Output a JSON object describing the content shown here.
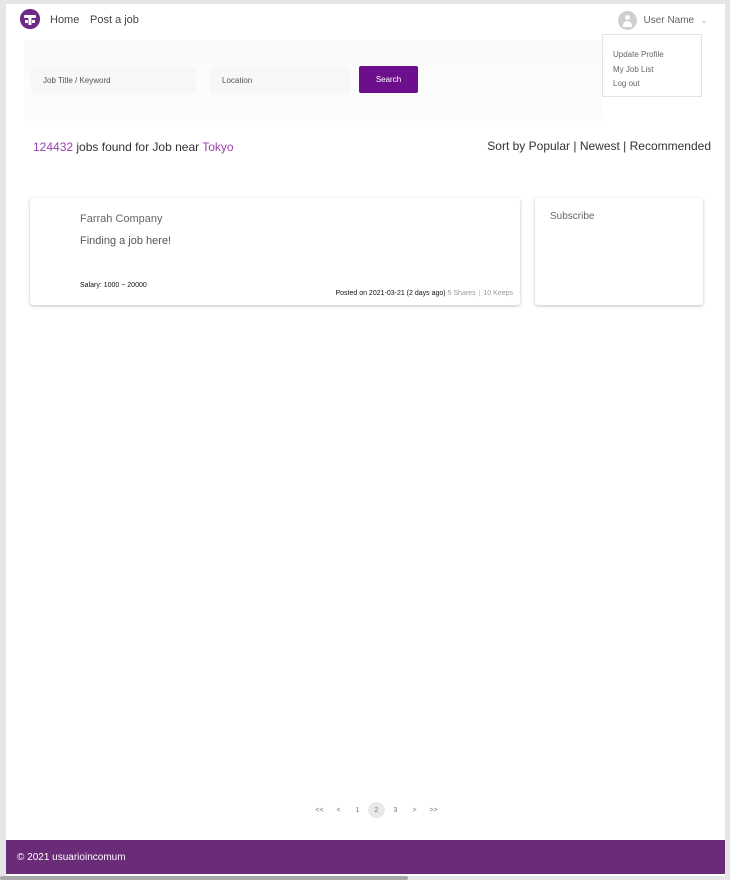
{
  "nav": {
    "home_label": "Home",
    "post_job_label": "Post a job"
  },
  "user": {
    "name": "User Name",
    "chevron": "⌄",
    "menu": [
      "Update Profile",
      "My Job List",
      "Log out"
    ]
  },
  "search": {
    "keyword_placeholder": "Job Title / Keyword",
    "location_placeholder": "Location",
    "button_label": "Search"
  },
  "results": {
    "count": "124432",
    "text": " jobs found for Job near ",
    "location": "Tokyo"
  },
  "sort": {
    "prefix": "Sort by ",
    "options": [
      "Popular",
      "Newest",
      "Recommended"
    ],
    "separator": " | "
  },
  "job": {
    "company": "Farrah Company",
    "title": "Finding a job here!",
    "salary": "Salary: 1000 ~ 20000",
    "posted": "Posted on 2021-03-21 (2 days ago)",
    "shares": "5 Shares",
    "keeps": "10 Keeps",
    "separator": "|"
  },
  "subscribe": {
    "title": "Subscribe"
  },
  "pagination": {
    "first": "<<",
    "prev": "<",
    "pages": [
      "1",
      "2",
      "3"
    ],
    "current": "2",
    "next": ">",
    "last": ">>"
  },
  "footer": {
    "text": "© 2021 usuarioincomum"
  },
  "colors": {
    "brand": "#6d0f8c",
    "footer": "#6a2c78",
    "accent_text": "#9b3fb0"
  },
  "icons": [
    "logo-icon",
    "user-avatar-icon",
    "chevron-down-icon"
  ]
}
